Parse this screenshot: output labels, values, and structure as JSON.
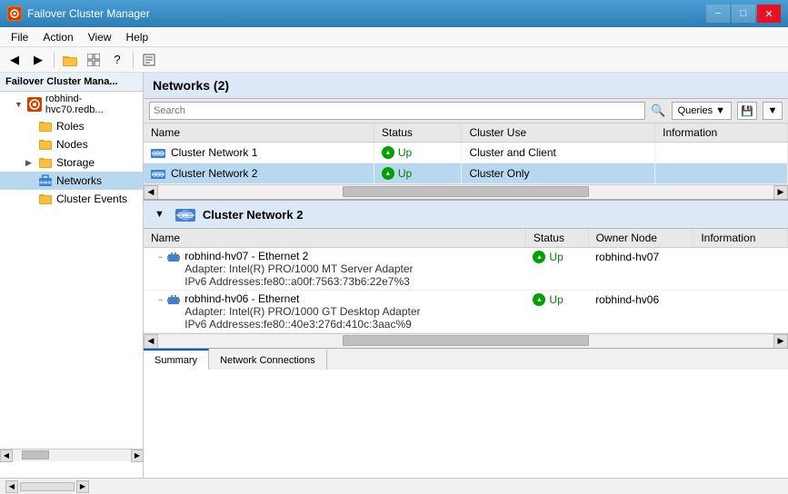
{
  "titleBar": {
    "title": "Failover Cluster Manager",
    "iconLabel": "FC",
    "minimizeLabel": "−",
    "maximizeLabel": "□",
    "closeLabel": "✕"
  },
  "menuBar": {
    "items": [
      {
        "id": "file",
        "label": "File"
      },
      {
        "id": "action",
        "label": "Action"
      },
      {
        "id": "view",
        "label": "View"
      },
      {
        "id": "help",
        "label": "Help"
      }
    ]
  },
  "toolbar": {
    "buttons": [
      {
        "id": "back",
        "label": "◀",
        "tooltip": "Back"
      },
      {
        "id": "forward",
        "label": "▶",
        "tooltip": "Forward"
      },
      {
        "id": "up",
        "label": "📁",
        "tooltip": "Up"
      },
      {
        "id": "show-hide",
        "label": "▦",
        "tooltip": "Show/Hide"
      },
      {
        "id": "help",
        "label": "?",
        "tooltip": "Help"
      },
      {
        "id": "properties",
        "label": "▤",
        "tooltip": "Properties"
      }
    ]
  },
  "sidebar": {
    "header": "Failover Cluster Mana...",
    "items": [
      {
        "id": "cluster-root",
        "label": "robhind-hvc70.redb...",
        "indent": 1,
        "hasArrow": true,
        "expanded": true,
        "icon": "cluster"
      },
      {
        "id": "roles",
        "label": "Roles",
        "indent": 2,
        "icon": "folder"
      },
      {
        "id": "nodes",
        "label": "Nodes",
        "indent": 2,
        "icon": "folder"
      },
      {
        "id": "storage",
        "label": "Storage",
        "indent": 2,
        "hasArrow": true,
        "icon": "folder"
      },
      {
        "id": "networks",
        "label": "Networks",
        "indent": 2,
        "icon": "network",
        "selected": true
      },
      {
        "id": "cluster-events",
        "label": "Cluster Events",
        "indent": 2,
        "icon": "folder"
      }
    ]
  },
  "contentHeader": {
    "title": "Networks (2)"
  },
  "searchBar": {
    "placeholder": "Search",
    "queriesLabel": "Queries",
    "saveLabel": "💾",
    "dropdownLabel": "▼"
  },
  "networksTable": {
    "columns": [
      "Name",
      "Status",
      "Cluster Use",
      "Information"
    ],
    "rows": [
      {
        "id": "net1",
        "name": "Cluster Network 1",
        "status": "Up",
        "clusterUse": "Cluster and Client",
        "information": "",
        "selected": false
      },
      {
        "id": "net2",
        "name": "Cluster Network 2",
        "status": "Up",
        "clusterUse": "Cluster Only",
        "information": "",
        "selected": true
      }
    ]
  },
  "bottomSection": {
    "networkName": "Cluster Network 2",
    "collapseLabel": "▼",
    "adaptersTable": {
      "columns": [
        "Name",
        "Status",
        "Owner Node",
        "Information"
      ],
      "rows": [
        {
          "id": "adapter1",
          "name": "robhind-hv07 - Ethernet 2",
          "adapterInfo": "Adapter: Intel(R) PRO/1000 MT Server Adapter",
          "ipv6": "IPv6 Addresses:fe80::a00f:7563:73b6:22e7%3",
          "status": "Up",
          "ownerNode": "robhind-hv07",
          "information": ""
        },
        {
          "id": "adapter2",
          "name": "robhind-hv06 - Ethernet",
          "adapterInfo": "Adapter: Intel(R) PRO/1000 GT Desktop Adapter",
          "ipv6": "IPv6 Addresses:fe80::40e3:276d:410c:3aac%9",
          "status": "Up",
          "ownerNode": "robhind-hv06",
          "information": ""
        }
      ]
    }
  },
  "tabs": [
    {
      "id": "summary",
      "label": "Summary",
      "active": true
    },
    {
      "id": "network-connections",
      "label": "Network Connections",
      "active": false
    }
  ]
}
